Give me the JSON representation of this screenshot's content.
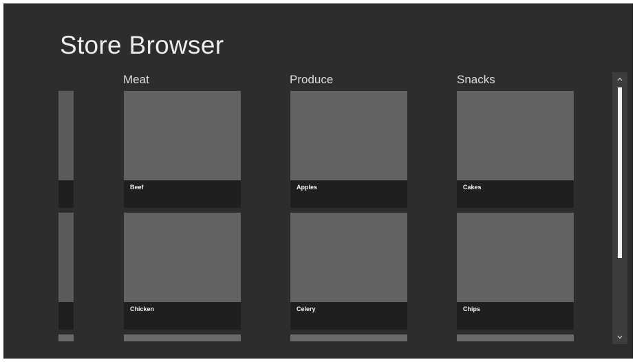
{
  "app": {
    "title": "Store Browser"
  },
  "groups": [
    {
      "header": "Meat",
      "items": [
        "Beef",
        "Chicken"
      ]
    },
    {
      "header": "Produce",
      "items": [
        "Apples",
        "Celery"
      ]
    },
    {
      "header": "Snacks",
      "items": [
        "Cakes",
        "Chips"
      ]
    }
  ],
  "scrollbar": {
    "up_icon": "chevron-up-icon",
    "down_icon": "chevron-down-icon"
  },
  "colors": {
    "background": "#2d2d2d",
    "tile": "#626262",
    "caption": "#1f1f1f",
    "thumb": "#f2f2f2"
  }
}
